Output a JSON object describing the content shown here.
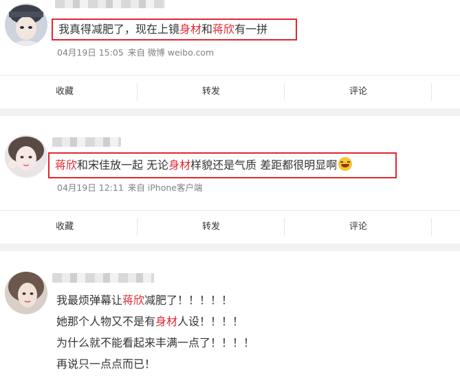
{
  "comments": [
    {
      "text_parts": [
        "我真得减肥了，现在上镜",
        "身材",
        "和",
        "蒋欣",
        "有一拼"
      ],
      "date": "04月19日 15:05",
      "source": "来自 微博 weibo.com"
    },
    {
      "text_parts": [
        "蒋欣",
        "和宋佳放一起 无论",
        "身材",
        "样貌还是气质 差距都很明显啊"
      ],
      "emoji": "laughing-crying-emoji",
      "date": "04月19日 12:11",
      "source": "来自 iPhone客户端"
    },
    {
      "lines": [
        [
          "我最烦弹幕让",
          "蒋欣",
          "减肥了！！！！！"
        ],
        [
          "她那个人物又不是有",
          "身材",
          "人设！！！！"
        ],
        [
          "为什么就不能看起来丰满一点了！！！！"
        ],
        [
          "再说只一点点而已！"
        ]
      ]
    }
  ],
  "actions": {
    "favorite": "收藏",
    "repost": "转发",
    "comment": "评论"
  },
  "colors": {
    "highlight": "#e0262f",
    "meta": "#808080",
    "divider": "#f2f2f5"
  }
}
